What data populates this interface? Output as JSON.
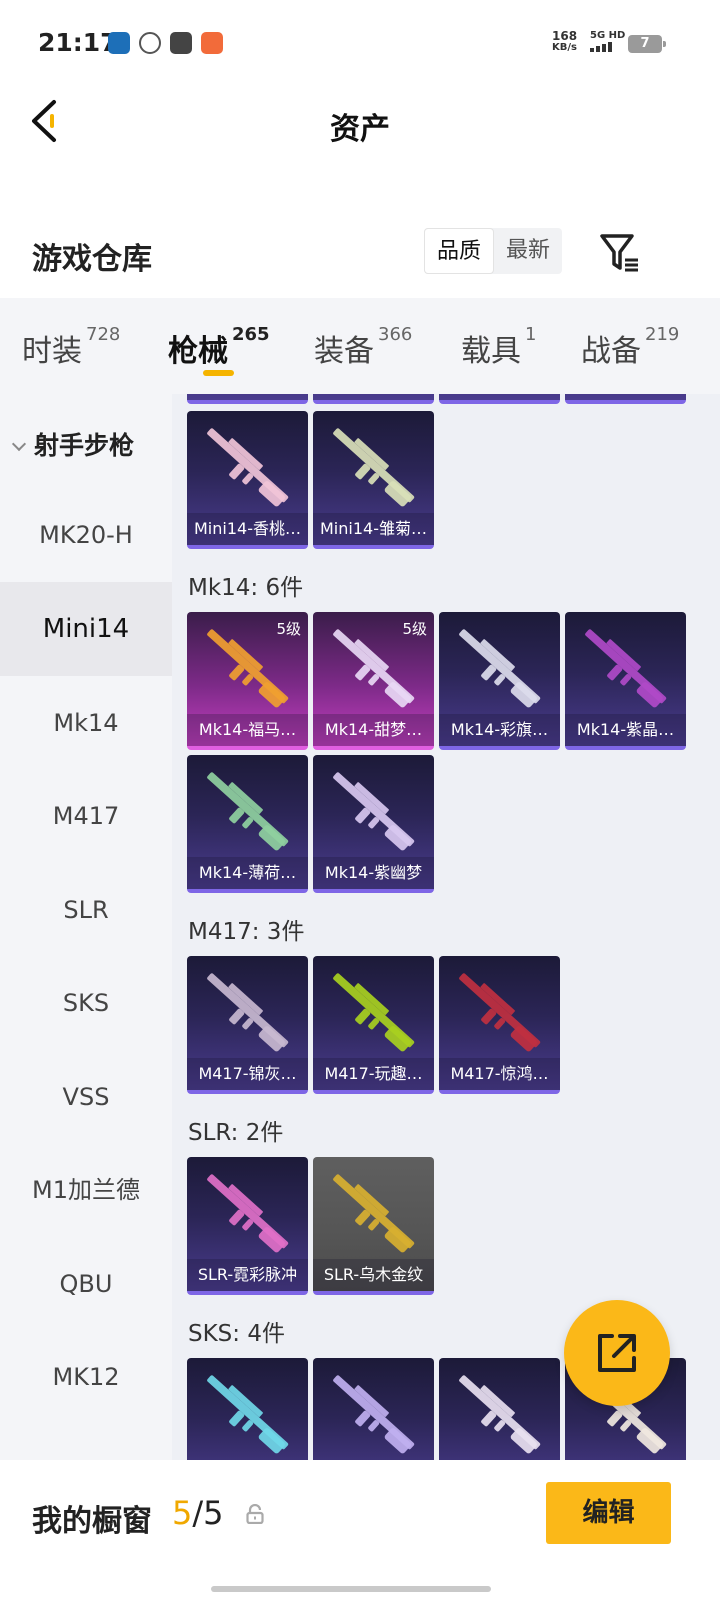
{
  "status_bar": {
    "time": "21:17",
    "speed_value": "168",
    "speed_unit": "KB/s",
    "network": "5G HD",
    "battery": "7"
  },
  "header": {
    "title": "资产"
  },
  "warehouse": {
    "title": "游戏仓库",
    "sort_options": [
      "品质",
      "最新"
    ],
    "active_sort": "品质"
  },
  "tabs": [
    {
      "label": "时装",
      "count": "728"
    },
    {
      "label": "枪械",
      "count": "265"
    },
    {
      "label": "装备",
      "count": "366"
    },
    {
      "label": "载具",
      "count": "1"
    },
    {
      "label": "战备",
      "count": "219"
    }
  ],
  "active_tab": "枪械",
  "sidebar": {
    "group": "射手步枪",
    "items": [
      "MK20-H",
      "Mini14",
      "Mk14",
      "M417",
      "SLR",
      "SKS",
      "VSS",
      "M1加兰德",
      "QBU",
      "MK12"
    ],
    "active_item": "Mini14"
  },
  "groups": {
    "mini14": {
      "items": [
        {
          "name": "Mini14-香桃…",
          "rarity": "epic"
        },
        {
          "name": "Mini14-雏菊…",
          "rarity": "epic"
        }
      ]
    },
    "mk14": {
      "label": "Mk14: 6件",
      "items": [
        {
          "name": "Mk14-福马…",
          "rarity": "legendary",
          "level": "5级"
        },
        {
          "name": "Mk14-甜梦…",
          "rarity": "legendary",
          "level": "5级"
        },
        {
          "name": "Mk14-彩旗…",
          "rarity": "epic"
        },
        {
          "name": "Mk14-紫晶…",
          "rarity": "epic"
        },
        {
          "name": "Mk14-薄荷…",
          "rarity": "epic"
        },
        {
          "name": "Mk14-紫幽梦",
          "rarity": "epic"
        }
      ]
    },
    "m417": {
      "label": "M417: 3件",
      "items": [
        {
          "name": "M417-锦灰…",
          "rarity": "epic"
        },
        {
          "name": "M417-玩趣…",
          "rarity": "epic"
        },
        {
          "name": "M417-惊鸿…",
          "rarity": "epic"
        }
      ]
    },
    "slr": {
      "label": "SLR: 2件",
      "items": [
        {
          "name": "SLR-霓彩脉冲",
          "rarity": "epic"
        },
        {
          "name": "SLR-乌木金纹",
          "rarity": "common"
        }
      ]
    },
    "sks": {
      "label": "SKS: 4件",
      "items": [
        {
          "name": "",
          "rarity": "epic"
        },
        {
          "name": "",
          "rarity": "epic"
        },
        {
          "name": "",
          "rarity": "epic"
        },
        {
          "name": "",
          "rarity": "epic"
        }
      ]
    }
  },
  "bottom": {
    "showcase_label": "我的橱窗",
    "showcase_used": "5",
    "showcase_total": "/5",
    "edit_label": "编辑"
  },
  "colors": {
    "accent": "#fbb818",
    "epic": "#7e66e6",
    "legendary": "#c33fbf"
  }
}
